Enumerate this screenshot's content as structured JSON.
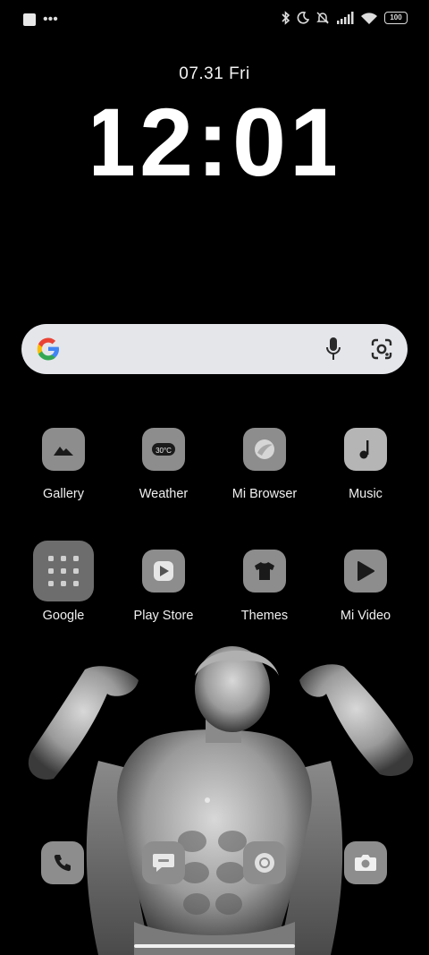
{
  "status_bar": {
    "battery_level": "100",
    "left_icons": [
      "notification-square-icon",
      "more-dots-icon"
    ],
    "right_icons": [
      "bluetooth-icon",
      "moon-icon",
      "bell-muted-icon",
      "signal-icon",
      "wifi-icon",
      "battery-icon"
    ]
  },
  "clock": {
    "date": "07.31  Fri",
    "time": "12:01"
  },
  "search_bar": {
    "icons": [
      "google-logo-icon",
      "microphone-icon",
      "google-lens-icon"
    ]
  },
  "apps": [
    {
      "label": "Gallery",
      "icon": "gallery-icon"
    },
    {
      "label": "Weather",
      "icon": "weather-icon",
      "badge": "30°C"
    },
    {
      "label": "Mi Browser",
      "icon": "browser-icon"
    },
    {
      "label": "Music",
      "icon": "music-icon"
    },
    {
      "label": "Google",
      "icon": "google-folder-icon"
    },
    {
      "label": "Play Store",
      "icon": "play-store-icon"
    },
    {
      "label": "Themes",
      "icon": "themes-icon"
    },
    {
      "label": "Mi Video",
      "icon": "video-icon"
    }
  ],
  "dock": [
    {
      "icon": "phone-icon"
    },
    {
      "icon": "messages-icon"
    },
    {
      "icon": "chrome-icon"
    },
    {
      "icon": "camera-icon"
    }
  ],
  "colors": {
    "background": "#000000",
    "tile": "#8d8d8d",
    "search_bar": "#e4e6ea"
  }
}
